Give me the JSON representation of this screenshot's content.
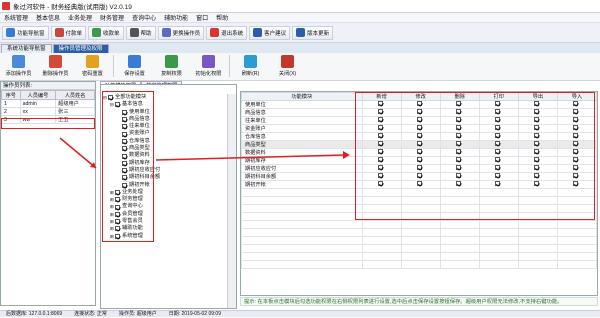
{
  "app": {
    "title": "象过河软件 - 财务经典版(试用版) V2.0.19"
  },
  "menu": [
    "系统管理",
    "基本信息",
    "业务处理",
    "财务管理",
    "查询中心",
    "辅助功能",
    "窗口",
    "帮助"
  ],
  "quick": [
    {
      "label": "功能导航窗",
      "color": "#3a7bd5"
    },
    {
      "label": "付款单",
      "color": "#c94a3a"
    },
    {
      "label": "收款单",
      "color": "#3b9a4a"
    },
    {
      "label": "帮助",
      "color": "#555"
    },
    {
      "label": "更换操作员",
      "color": "#5c6bc0"
    },
    {
      "label": "退出系统",
      "color": "#d33"
    },
    {
      "label": "客户建议",
      "color": "#2b5da8"
    },
    {
      "label": "版本更新",
      "color": "#2b5da8"
    }
  ],
  "doc_tabs": [
    "系统功能导航窗",
    "操作员管理及权限"
  ],
  "ribbon": [
    {
      "label": "添加操作员",
      "color": "#4a8ad6"
    },
    {
      "label": "删除操作员",
      "color": "#d24a3a"
    },
    {
      "label": "密码重置",
      "color": "#e0a21f"
    },
    {
      "label": "保存设置",
      "color": "#3a7bd5"
    },
    {
      "label": "复制权限",
      "color": "#3b9a4a"
    },
    {
      "label": "初始化权限",
      "color": "#7a57c1"
    },
    {
      "label": "刷新(R)",
      "color": "#2e9bd2"
    },
    {
      "label": "关闭(X)",
      "color": "#c0392b"
    }
  ],
  "operators": {
    "caption": "操作员列表:",
    "columns": [
      "序号",
      "人员编号",
      "人员姓名"
    ],
    "rows": [
      [
        "1",
        "admin",
        "超级用户"
      ],
      [
        "2",
        "xx",
        "张三"
      ],
      [
        "3",
        "ww",
        "王五"
      ]
    ]
  },
  "sub_tabs": [
    "功能模块权限",
    "其它管理权限"
  ],
  "tree": [
    {
      "label": "全部功能模块",
      "level": 0,
      "exp": "⊟"
    },
    {
      "label": "基本信息",
      "level": 1,
      "exp": "⊟"
    },
    {
      "label": "使用单位",
      "level": 2,
      "exp": ""
    },
    {
      "label": "商品信息",
      "level": 2,
      "exp": ""
    },
    {
      "label": "往来单位",
      "level": 2,
      "exp": ""
    },
    {
      "label": "资金账户",
      "level": 2,
      "exp": ""
    },
    {
      "label": "仓库信息",
      "level": 2,
      "exp": ""
    },
    {
      "label": "商品类型",
      "level": 2,
      "exp": ""
    },
    {
      "label": "数据资料",
      "level": 2,
      "exp": ""
    },
    {
      "label": "期初库存",
      "level": 2,
      "exp": ""
    },
    {
      "label": "期初应收应付",
      "level": 2,
      "exp": ""
    },
    {
      "label": "期初科目余额",
      "level": 2,
      "exp": ""
    },
    {
      "label": "期初开帐",
      "level": 2,
      "exp": ""
    },
    {
      "label": "业务处理",
      "level": 1,
      "exp": "⊞"
    },
    {
      "label": "财务管理",
      "level": 1,
      "exp": "⊞"
    },
    {
      "label": "查询中心",
      "level": 1,
      "exp": "⊞"
    },
    {
      "label": "会员管理",
      "level": 1,
      "exp": "⊞"
    },
    {
      "label": "零售会员",
      "level": 1,
      "exp": "⊞"
    },
    {
      "label": "辅助功能",
      "level": 1,
      "exp": "⊞"
    },
    {
      "label": "系统管理",
      "level": 1,
      "exp": "⊞"
    }
  ],
  "perm": {
    "columns": [
      "功能模块",
      "新增",
      "修改",
      "删除",
      "打印",
      "导出",
      "导入"
    ],
    "rows": [
      "使用单位",
      "商品信息",
      "往来单位",
      "资金账户",
      "仓库信息",
      "商品类型",
      "数据资料",
      "期初库存",
      "期初应收应付",
      "期初科目余额",
      "期初开帐"
    ]
  },
  "hint": "提示: 在本板点击模块后勾选功能权限在右侧权限列表进行设置,选中后点击保存设置按钮保存。超级用户权限无法修改,不支持右键功能。",
  "status": [
    "后数据库: 127.0.0.1:8069",
    "连接状态: 正常",
    "操作员: 超级用户",
    "日期: 2019-05-02 09:09"
  ]
}
